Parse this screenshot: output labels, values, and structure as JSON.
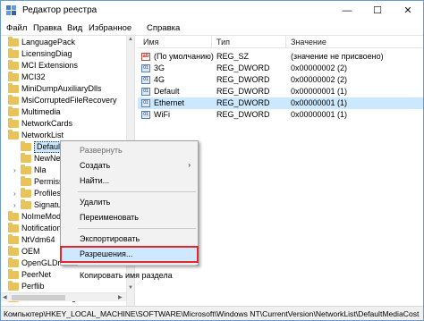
{
  "window": {
    "title": "Редактор реестра",
    "controls": {
      "minimize": "—",
      "maximize": "☐",
      "close": "✕"
    }
  },
  "menu": [
    "Файл",
    "Правка",
    "Вид",
    "Избранное",
    "Справка"
  ],
  "tree": {
    "items": [
      {
        "label": "LanguagePack",
        "indent": 0
      },
      {
        "label": "LicensingDiag",
        "indent": 0
      },
      {
        "label": "MCI Extensions",
        "indent": 0
      },
      {
        "label": "MCI32",
        "indent": 0
      },
      {
        "label": "MiniDumpAuxiliaryDlls",
        "indent": 0
      },
      {
        "label": "MsiCorruptedFileRecovery",
        "indent": 0
      },
      {
        "label": "Multimedia",
        "indent": 0
      },
      {
        "label": "NetworkCards",
        "indent": 0
      },
      {
        "label": "NetworkList",
        "indent": 0,
        "expanded": true
      },
      {
        "label": "DefaultMediaCost",
        "indent": 1,
        "selected": true
      },
      {
        "label": "NewNet",
        "indent": 1
      },
      {
        "label": "Nla",
        "indent": 1,
        "expander": true
      },
      {
        "label": "Permissions",
        "indent": 1
      },
      {
        "label": "Profiles",
        "indent": 1,
        "expander": true
      },
      {
        "label": "Signatu",
        "indent": 1,
        "expander": true
      },
      {
        "label": "NoImeModel",
        "indent": 0
      },
      {
        "label": "Notification",
        "indent": 0
      },
      {
        "label": "NtVdm64",
        "indent": 0
      },
      {
        "label": "OEM",
        "indent": 0
      },
      {
        "label": "OpenGLDrivers",
        "indent": 0
      },
      {
        "label": "PeerNet",
        "indent": 0
      },
      {
        "label": "Perflib",
        "indent": 0
      },
      {
        "label": "PerHwIdStorage",
        "indent": 0
      }
    ]
  },
  "list": {
    "columns": [
      "Имя",
      "Тип",
      "Значение"
    ],
    "rows": [
      {
        "name": "(По умолчанию)",
        "type": "REG_SZ",
        "value": "(значение не присвоено)",
        "icon": "string-value-icon"
      },
      {
        "name": "3G",
        "type": "REG_DWORD",
        "value": "0x00000002 (2)",
        "icon": "dword-value-icon"
      },
      {
        "name": "4G",
        "type": "REG_DWORD",
        "value": "0x00000002 (2)",
        "icon": "dword-value-icon"
      },
      {
        "name": "Default",
        "type": "REG_DWORD",
        "value": "0x00000001 (1)",
        "icon": "dword-value-icon"
      },
      {
        "name": "Ethernet",
        "type": "REG_DWORD",
        "value": "0x00000001 (1)",
        "icon": "dword-value-icon",
        "selected": true
      },
      {
        "name": "WiFi",
        "type": "REG_DWORD",
        "value": "0x00000001 (1)",
        "icon": "dword-value-icon"
      }
    ]
  },
  "context_menu": {
    "items": [
      {
        "label": "Развернуть",
        "disabled": true
      },
      {
        "label": "Создать",
        "submenu": true
      },
      {
        "label": "Найти..."
      },
      {
        "separator": true
      },
      {
        "label": "Удалить"
      },
      {
        "label": "Переименовать"
      },
      {
        "separator": true
      },
      {
        "label": "Экспортировать"
      },
      {
        "label": "Разрешения...",
        "highlighted": true
      },
      {
        "separator": true
      },
      {
        "label": "Копировать имя раздела"
      }
    ]
  },
  "status": "Компьютер\\HKEY_LOCAL_MACHINE\\SOFTWARE\\Microsoft\\Windows NT\\CurrentVersion\\NetworkList\\DefaultMediaCost"
}
